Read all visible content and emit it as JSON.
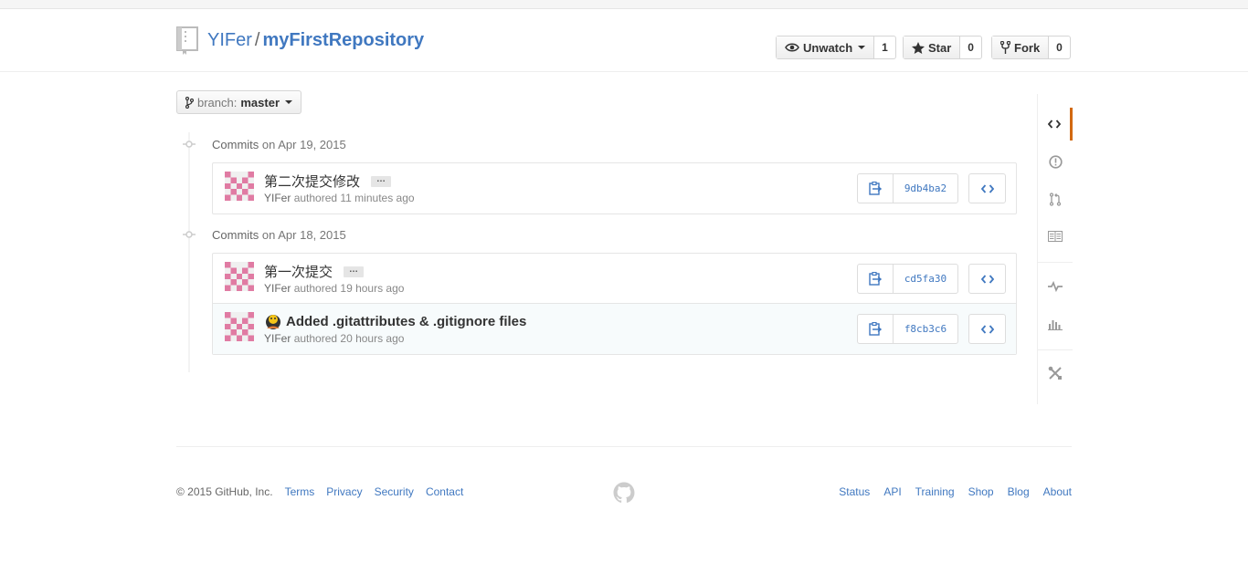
{
  "repo": {
    "owner": "YIFer",
    "separator": "/",
    "name": "myFirstRepository"
  },
  "actions": {
    "watch": {
      "label": "Unwatch",
      "count": "1"
    },
    "star": {
      "label": "Star",
      "count": "0"
    },
    "fork": {
      "label": "Fork",
      "count": "0"
    }
  },
  "branch": {
    "prefix": "branch:",
    "value": "master"
  },
  "commit_days": [
    {
      "heading_prefix": "Commits",
      "heading_date": "on Apr 19, 2015",
      "commits": [
        {
          "message": "第二次提交修改",
          "author": "YIFer",
          "time": "authored 11 minutes ago",
          "sha": "9db4ba2"
        }
      ]
    },
    {
      "heading_prefix": "Commits",
      "heading_date": "on Apr 18, 2015",
      "commits": [
        {
          "message": "第一次提交",
          "author": "YIFer",
          "time": "authored 19 hours ago",
          "sha": "cd5fa30"
        },
        {
          "message": "Added .gitattributes & .gitignore files",
          "author": "YIFer",
          "time": "authored 20 hours ago",
          "sha": "f8cb3c6"
        }
      ]
    }
  ],
  "ellipsis_label": "…",
  "sidenav": [
    "code-icon",
    "issues-icon",
    "pull-requests-icon",
    "wiki-icon",
    "pulse-icon",
    "graphs-icon",
    "settings-icon"
  ],
  "colors": {
    "link": "#4078c0",
    "selected_nav": "#d26911",
    "identicon": "#e07ba3"
  },
  "footer": {
    "copyright": "© 2015 GitHub, Inc.",
    "left_links": [
      "Terms",
      "Privacy",
      "Security",
      "Contact"
    ],
    "right_links": [
      "Status",
      "API",
      "Training",
      "Shop",
      "Blog",
      "About"
    ]
  }
}
